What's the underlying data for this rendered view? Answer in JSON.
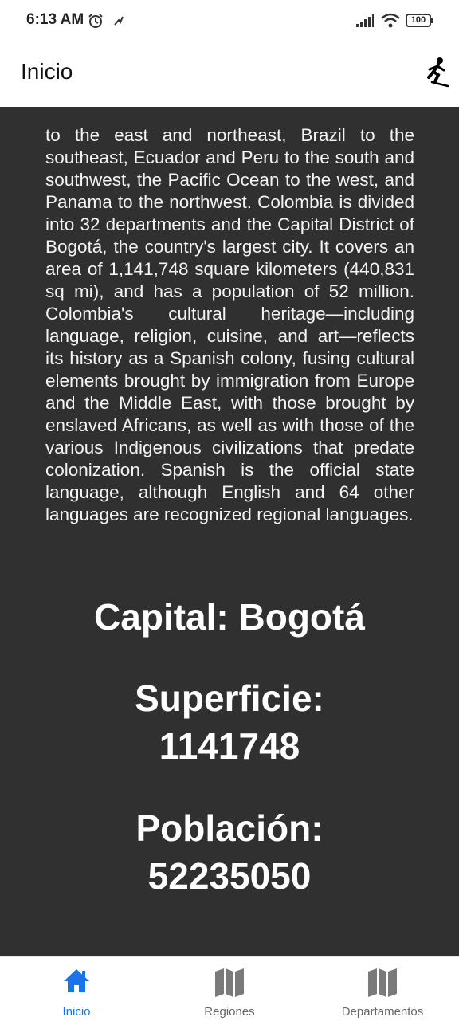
{
  "status_bar": {
    "time": "6:13 AM",
    "battery": "100",
    "icons": [
      "alarm-icon",
      "app-notification-icon",
      "signal-icon",
      "wifi-icon",
      "battery-icon"
    ]
  },
  "app_bar": {
    "title": "Inicio",
    "action_icon": "skater-icon"
  },
  "main": {
    "description": "to the east and northeast, Brazil to the southeast, Ecuador and Peru to the south and southwest, the Pacific Ocean to the west, and Panama to the northwest. Colombia is divided into 32 departments and the Capital District of Bogotá, the country's largest city. It covers an area of 1,141,748 square kilometers (440,831 sq mi), and has a population of 52 million. Colombia's cultural heritage—including language, religion, cuisine, and art—reflects its history as a Spanish colony, fusing cultural elements brought by immigration from Europe and the Middle East, with those brought by enslaved Africans, as well as with those of the various Indigenous civilizations that predate colonization. Spanish is the official state language, although English and 64 other languages are recognized regional languages.",
    "capital": "Capital: Bogotá",
    "area_label": "Superficie:",
    "area_value": "1141748",
    "population_label": "Población:",
    "population_value": "52235050",
    "background_color": "#303030"
  },
  "bottom_nav": {
    "items": [
      {
        "label": "Inicio",
        "icon": "home-icon",
        "active": true
      },
      {
        "label": "Regiones",
        "icon": "map-icon",
        "active": false
      },
      {
        "label": "Departamentos",
        "icon": "map-icon",
        "active": false
      }
    ],
    "active_color": "#1a73e8",
    "inactive_color": "#666666"
  }
}
